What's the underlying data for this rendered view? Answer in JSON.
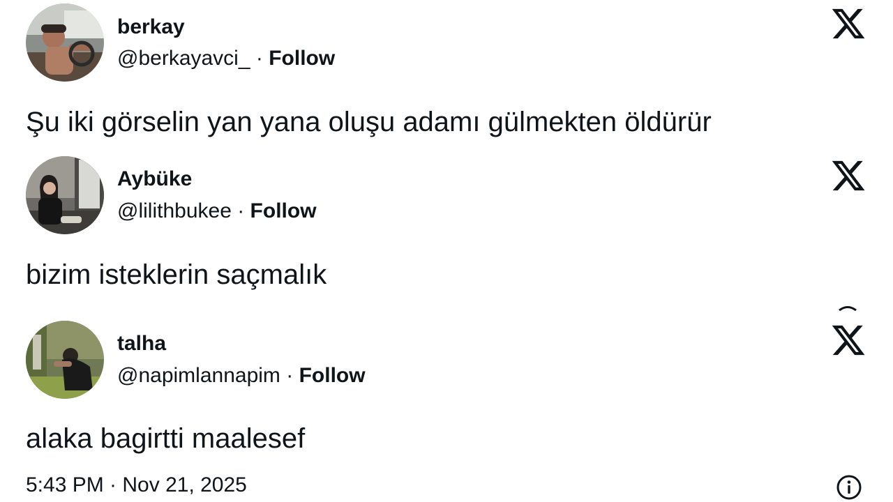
{
  "posts": [
    {
      "name": "berkay",
      "handle": "@berkayavci_",
      "separator": " · ",
      "follow_label": "Follow",
      "text": "Şu iki görselin yan yana oluşu adamı gülmekten öldürür",
      "avatar_icon": "avatar-photo-driver",
      "brand_icon": "x-logo-icon"
    },
    {
      "name": "Aybüke",
      "handle": "@lilithbukee",
      "separator": " · ",
      "follow_label": "Follow",
      "text": "bizim isteklerin saçmalık",
      "avatar_icon": "avatar-photo-woman",
      "brand_icon": "x-logo-icon"
    },
    {
      "name": "talha",
      "handle": "@napimlannapim",
      "separator": " · ",
      "follow_label": "Follow",
      "text": "alaka bagirtti maalesef",
      "avatar_icon": "avatar-photo-man",
      "brand_icon": "x-logo-icon"
    }
  ],
  "footer": {
    "timestamp": "5:43 PM · Nov 21, 2025",
    "info_icon": "info-icon"
  },
  "colors": {
    "text": "#0f1419",
    "background": "#ffffff"
  }
}
